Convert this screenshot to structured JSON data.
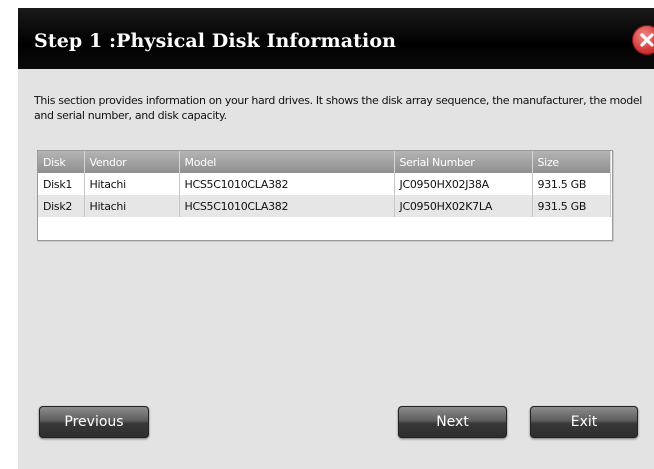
{
  "dialog": {
    "title": "Step 1 :Physical Disk Information",
    "close_icon": "close-x-icon",
    "description": "This section provides information on your hard drives. It shows the disk array sequence, the manufacturer, the model and serial number, and disk capacity."
  },
  "table": {
    "columns": [
      "Disk",
      "Vendor",
      "Model",
      "Serial Number",
      "Size"
    ],
    "rows": [
      {
        "disk": "Disk1",
        "vendor": "Hitachi",
        "model": "HCS5C1010CLA382",
        "serial": "JC0950HX02J38A",
        "size": "931.5 GB"
      },
      {
        "disk": "Disk2",
        "vendor": "Hitachi",
        "model": "HCS5C1010CLA382",
        "serial": "JC0950HX02K7LA",
        "size": "931.5 GB"
      }
    ]
  },
  "buttons": {
    "previous": "Previous",
    "next": "Next",
    "exit": "Exit"
  },
  "colors": {
    "titlebar": "#000000",
    "dialog_bg": "#e3e3e3",
    "close_red": "#d23a3a",
    "header_gray": "#9e9e9e"
  }
}
